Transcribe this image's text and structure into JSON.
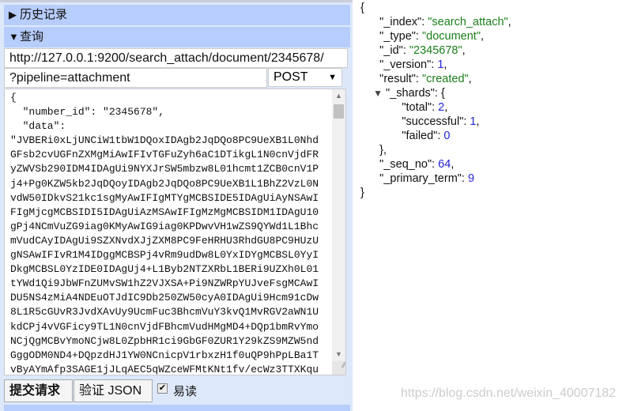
{
  "history_section": {
    "label": "历史记录",
    "icon": "triangle-right-icon"
  },
  "query_section": {
    "label": "查询",
    "icon": "triangle-down-icon"
  },
  "request": {
    "url": "http://127.0.0.1:9200/search_attach/document/2345678/",
    "path": "?pipeline=attachment",
    "method": "POST"
  },
  "body_lines": [
    "{",
    "  \"number_id\": \"2345678\",",
    "  \"data\":",
    "\"JVBERi0xLjUNCiW1tbW1DQoxIDAgb2JqDQo8PC9UeXB1L0Nhd",
    "GFsb2cvUGFnZXMgMiAwIFIvTGFuZyh6aC1DTikgL1N0cnVjdFR",
    "yZWVSb290IDM4IDAgUi9NYXJrSW5mbzw8L01hcmt1ZCB0cnV1P",
    "j4+Pg0KZW5kb2JqDQoyIDAgb2JqDQo8PC9UeXB1L1BhZ2VzL0N",
    "vdW50IDkvS21kc1sgMyAwIFIgMTYgMCBSIDE5IDAgUiAyNSAwI",
    "FIgMjcgMCBSIDI5IDAgUiAzMSAwIFIgMzMgMCBSIDM1IDAgU10",
    "gPj4NCmVuZG9iag0KMyAwIG9iag0KPDwvVH1wZS9QYWd1L1Bhc",
    "mVudCAyIDAgUi9SZXNvdXJjZXM8PC9FeHRHU3RhdGU8PC9HUzU",
    "gNSAwIFIvR1M4IDggMCBSPj4vRm9udDw8L0YxIDYgMCBSL0YyI",
    "DkgMCBSL0YzIDE0IDAgUj4+L1Byb2NTZXRbL1BERi9UZXh0L01",
    "tYWd1Qi9JbWFnZUMvSW1hZ2VJXSA+Pi9NZWRpYUJveFsgMCAwI",
    "DU5NS4zMiA4NDEuOTJdIC9Db250ZW50cyA0IDAgUi9Hcm91cDw",
    "8L1R5cGUvR3JvdXAvUy9UcmFuc3BhcmVuY3kvQ1MvRGV2aWN1U",
    "kdCPj4vVGFicy9TL1N0cnVjdFBhcmVudHMgMD4+DQp1bmRvYmo",
    "NCjQgMCBvYmoNCjw8L0ZpbHR1ci9GbGF0ZUR1Y29kZS9MZW5nd",
    "GggODM0ND4+DQpzdHJ1YW0NCnicpV1rbxzH1f0uQP9hPpLBa1T",
    "vByAYmAfp3SAGE1jJLqAEC5qWZceWFMtKNt1fv/ecWz3TTXKqu"
  ],
  "buttons": {
    "submit": "提交请求",
    "validate": "验证 JSON"
  },
  "pretty": {
    "label": "易读",
    "checked": true
  },
  "response": {
    "_index": "search_attach",
    "_type": "document",
    "_id": "2345678",
    "_version": "1",
    "result": "created",
    "_shards": {
      "total": "2",
      "successful": "1",
      "failed": "0"
    },
    "_seq_no": "64",
    "_primary_term": "9"
  },
  "response_syntax": {
    "brace_open": "{",
    "brace_close": "}",
    "shards_close": "},"
  },
  "watermark": "https://blog.csdn.net/weixin_40007182",
  "colors": {
    "section_header": "#b7cdfc",
    "panel_bg": "#dde8fb",
    "string": "#1a7f1a",
    "number": "#2424d8"
  }
}
